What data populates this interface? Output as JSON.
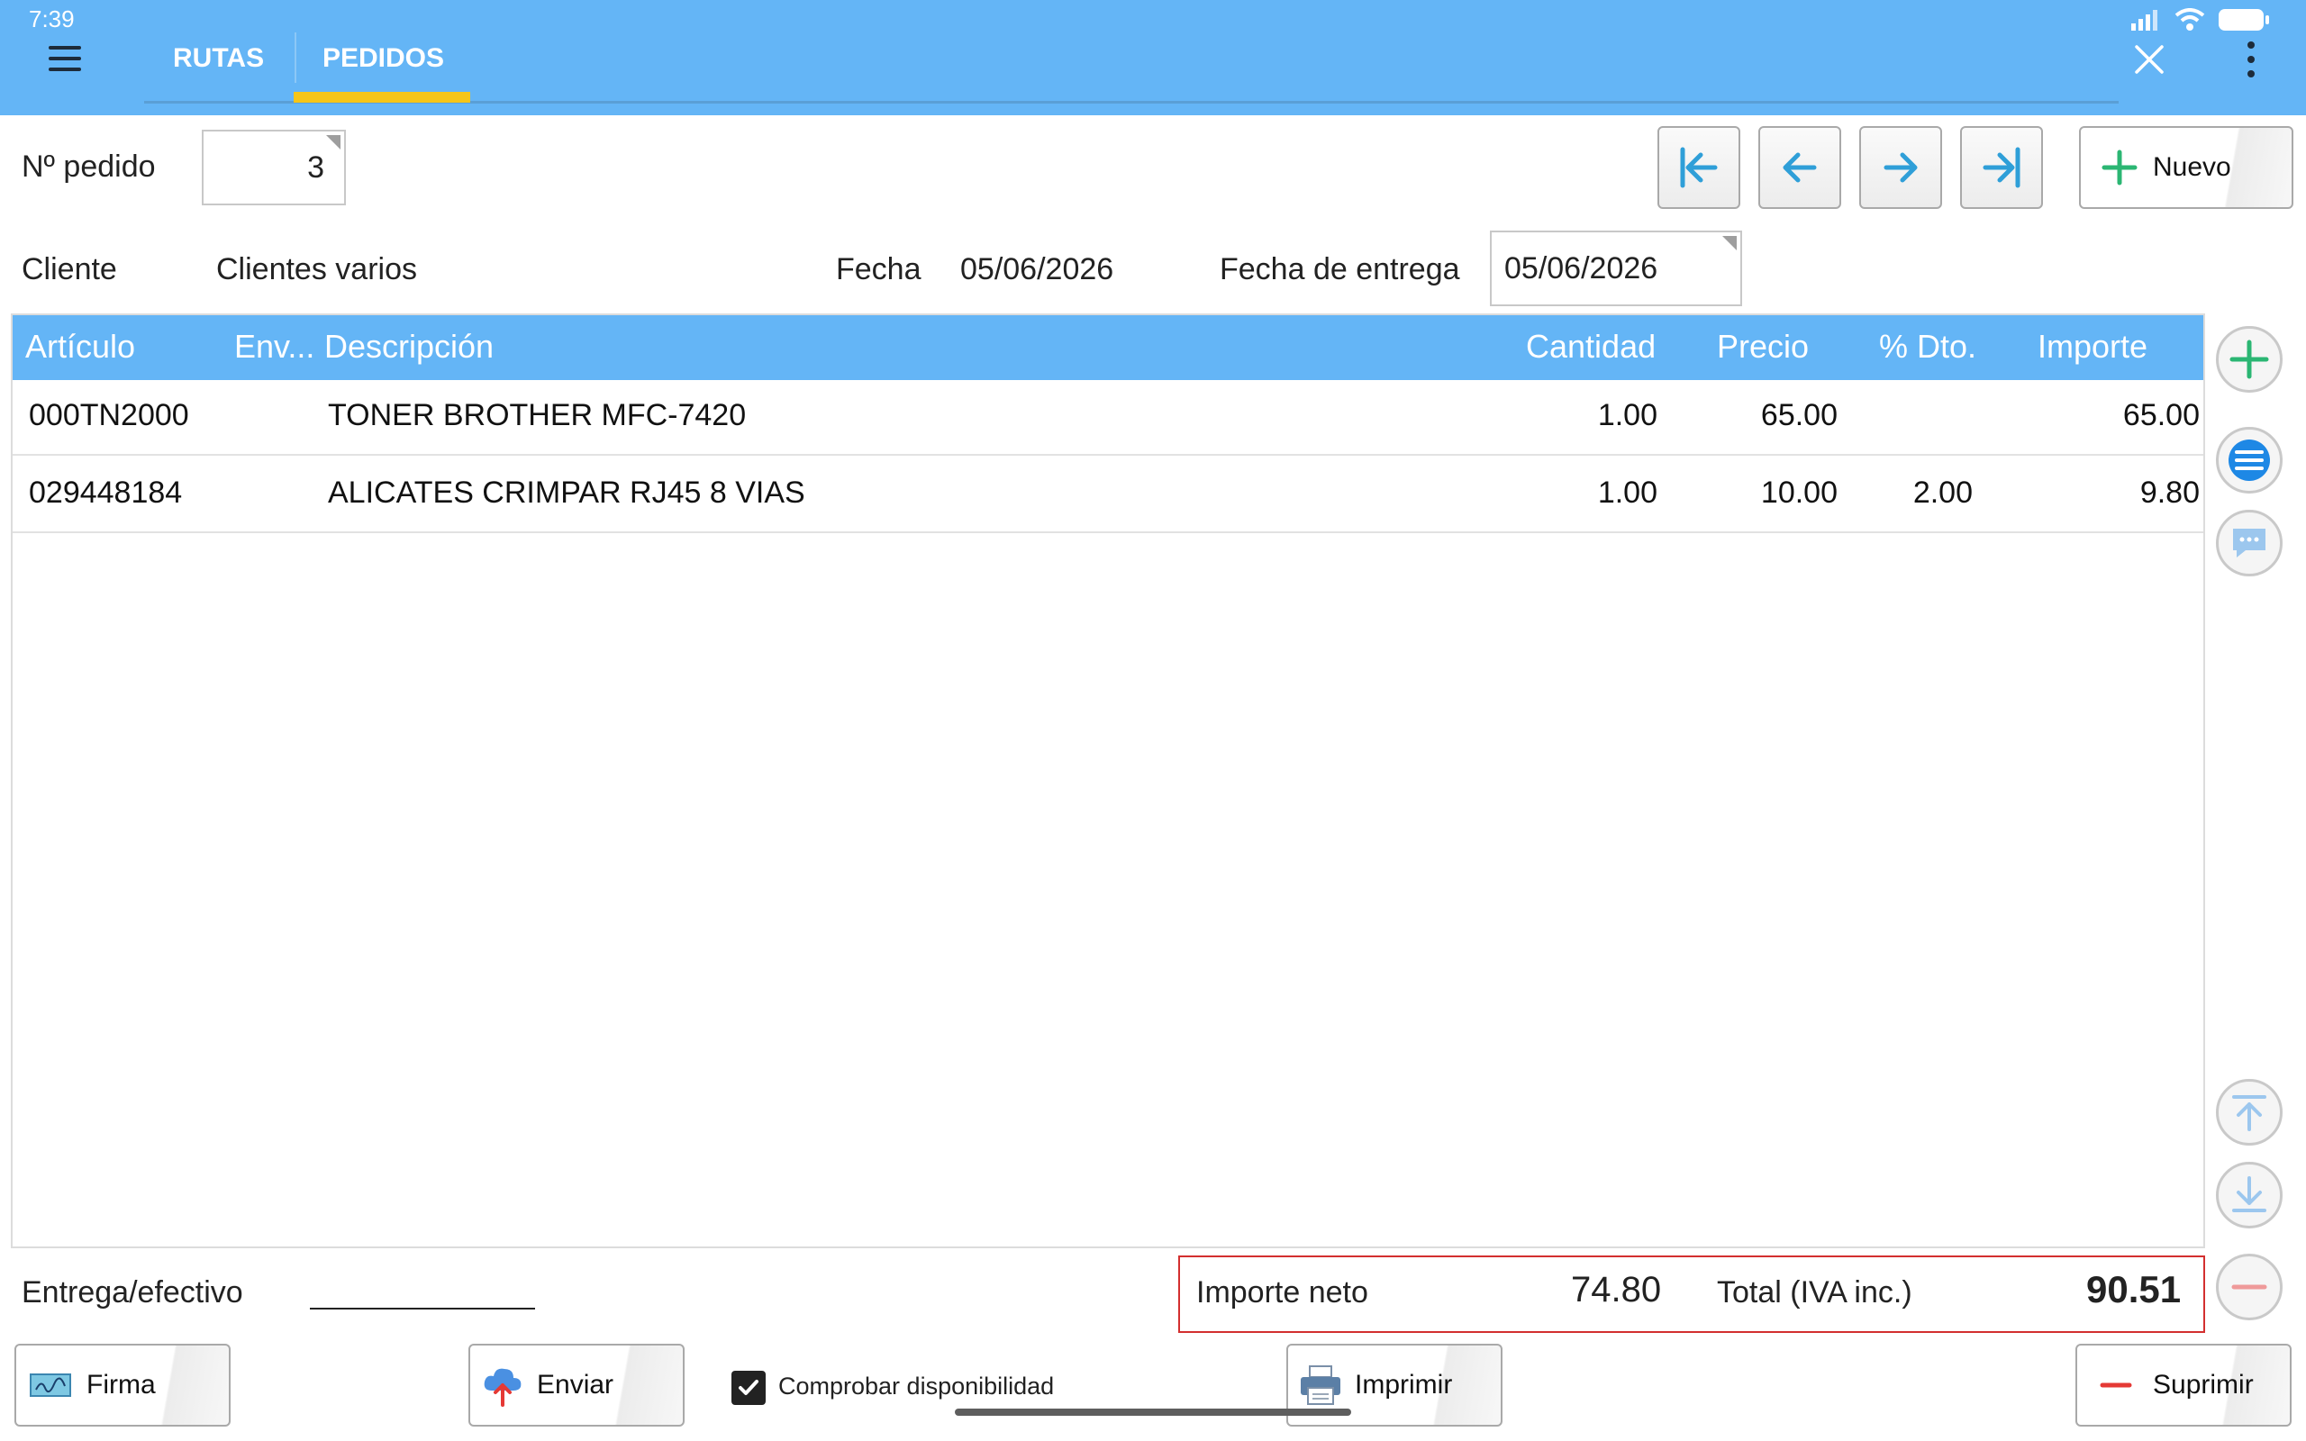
{
  "status": {
    "time": "7:39"
  },
  "tabs": [
    {
      "label": "RUTAS",
      "active": false
    },
    {
      "label": "PEDIDOS",
      "active": true
    }
  ],
  "form": {
    "order_no_label": "Nº pedido",
    "order_no_value": "3",
    "client_label": "Cliente",
    "client_value": "Clientes varios",
    "date_label": "Fecha",
    "date_value": "05/06/2026",
    "delivery_date_label": "Fecha de entrega",
    "delivery_date_value": "05/06/2026"
  },
  "nav": {
    "first_icon": "first-page-icon",
    "prev_icon": "arrow-left-icon",
    "next_icon": "arrow-right-icon",
    "last_icon": "last-page-icon",
    "new_label": "Nuevo"
  },
  "table": {
    "columns": [
      "Artículo",
      "Env...",
      "Descripción",
      "Cantidad",
      "Precio",
      "% Dto.",
      "Importe"
    ],
    "rows": [
      {
        "article": "000TN2000",
        "env": "",
        "description": "TONER BROTHER MFC-7420",
        "qty": "1.00",
        "price": "65.00",
        "discount": "",
        "amount": "65.00"
      },
      {
        "article": "029448184",
        "env": "",
        "description": "ALICATES CRIMPAR RJ45 8 VIAS",
        "qty": "1.00",
        "price": "10.00",
        "discount": "2.00",
        "amount": "9.80"
      }
    ]
  },
  "footer": {
    "cash_label": "Entrega/efectivo",
    "cash_value": "",
    "net_label": "Importe neto",
    "net_value": "74.80",
    "total_label": "Total (IVA inc.)",
    "total_value": "90.51",
    "check_label": "Comprobar disponibilidad",
    "check_checked": true
  },
  "actions": {
    "sign_label": "Firma",
    "send_label": "Enviar",
    "print_label": "Imprimir",
    "delete_label": "Suprimir"
  },
  "colors": {
    "appbar": "#64b5f6",
    "tab_indicator": "#f5c518",
    "accent_green": "#2bb673",
    "accent_blue": "#1e88e5",
    "totals_border": "#d32f2f"
  }
}
